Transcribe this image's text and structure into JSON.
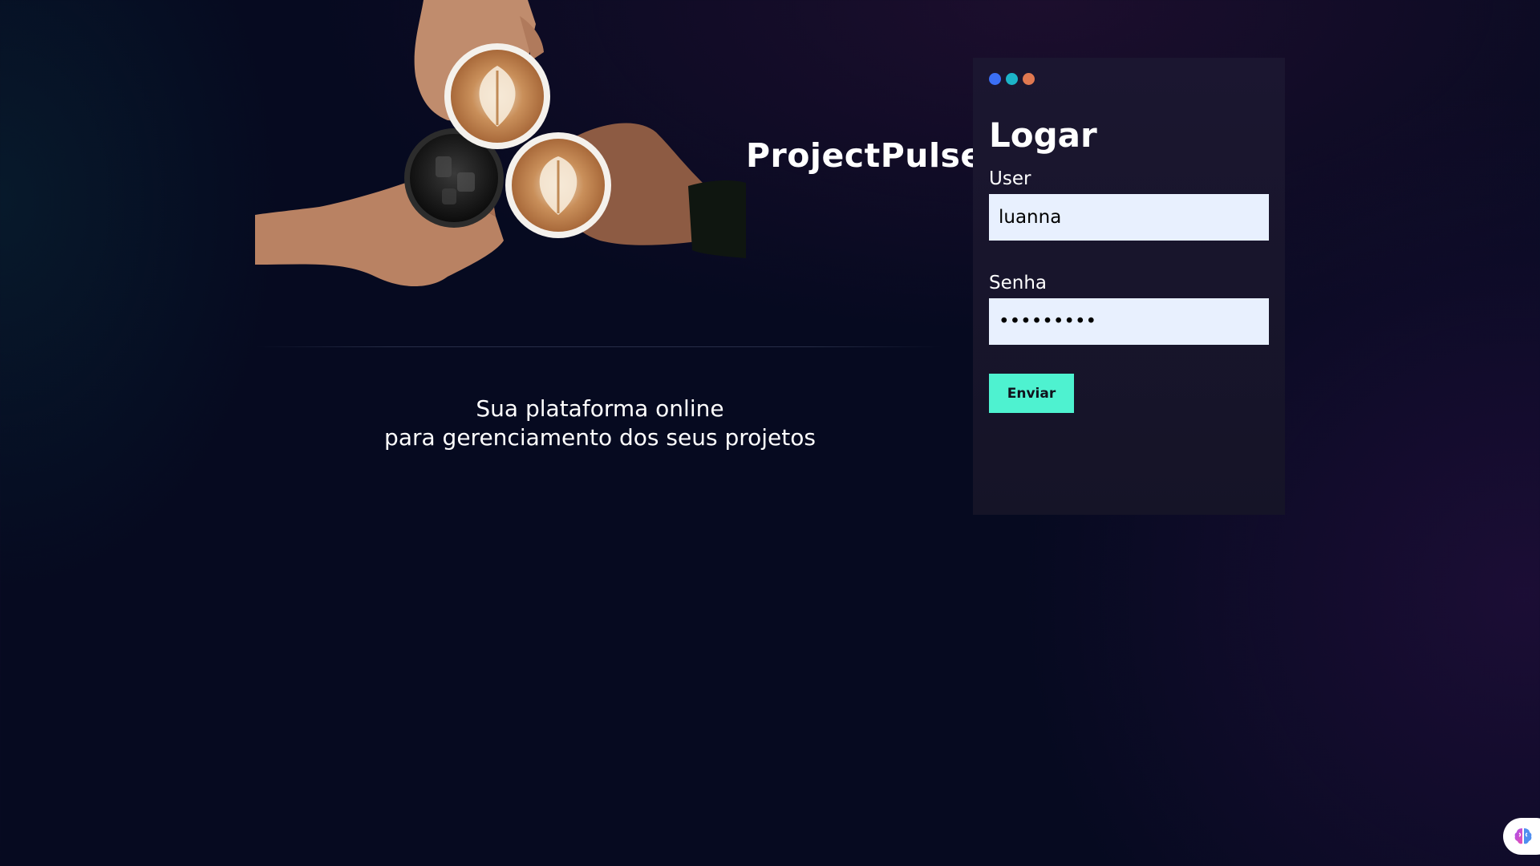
{
  "app": {
    "title": "ProjectPulse",
    "tagline_line1": "Sua plataforma online",
    "tagline_line2": "para gerenciamento dos seus projetos"
  },
  "login": {
    "heading": "Logar",
    "window_dots": [
      "#3b6ff5",
      "#1cb4c8",
      "#e07850"
    ],
    "user_label": "User",
    "user_value": "luanna",
    "password_label": "Senha",
    "password_value": "luanna123",
    "submit_label": "Enviar",
    "accent_color": "#4ef2d0"
  },
  "hero_image": {
    "icon": "coffee-cups-photo"
  },
  "assistant": {
    "icon": "brain-icon"
  }
}
